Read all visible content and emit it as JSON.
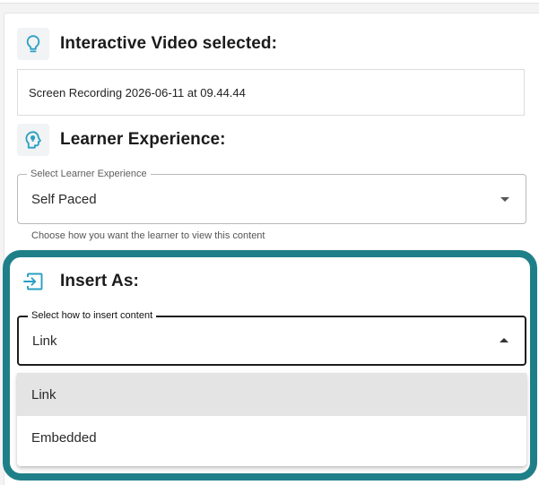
{
  "colors": {
    "accent": "#1f7f89",
    "icon": "#2a9fc3",
    "selected_option_bg": "#e4e4e4"
  },
  "interactive_video": {
    "icon": "lightbulb-icon",
    "title": "Interactive Video selected:",
    "value": "Screen Recording 2026-06-11 at 09.44.44"
  },
  "learner_experience": {
    "icon": "head-lightbulb-icon",
    "title": "Learner Experience:",
    "select_label": "Select Learner Experience",
    "selected_value": "Self Paced",
    "helper_text": "Choose how you want the learner to view this content"
  },
  "insert_as": {
    "icon": "insert-arrow-icon",
    "title": "Insert As:",
    "select_label": "Select how to insert content",
    "selected_value": "Link",
    "options": [
      {
        "label": "Link",
        "selected": true
      },
      {
        "label": "Embedded",
        "selected": false
      }
    ]
  }
}
